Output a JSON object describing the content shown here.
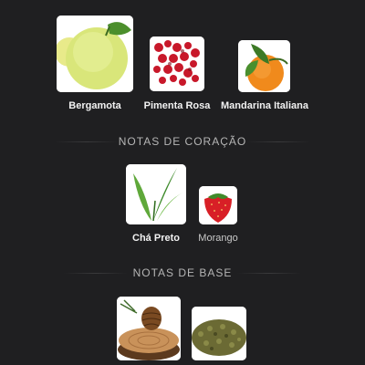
{
  "top_notes": [
    {
      "label": "Bergamota",
      "icon": "bergamot-image"
    },
    {
      "label": "Pimenta Rosa",
      "icon": "pink-pepper-image"
    },
    {
      "label": "Mandarina Italiana",
      "icon": "mandarin-image"
    }
  ],
  "heart": {
    "title": "NOTAS DE CORAÇÃO",
    "notes": [
      {
        "label": "Chá Preto",
        "icon": "tea-leaf-image"
      },
      {
        "label": "Morango",
        "icon": "strawberry-image"
      }
    ]
  },
  "base": {
    "title": "NOTAS DE BASE",
    "notes": [
      {
        "label": "",
        "icon": "pinecone-wood-image"
      },
      {
        "label": "",
        "icon": "dried-herbs-image"
      }
    ]
  }
}
